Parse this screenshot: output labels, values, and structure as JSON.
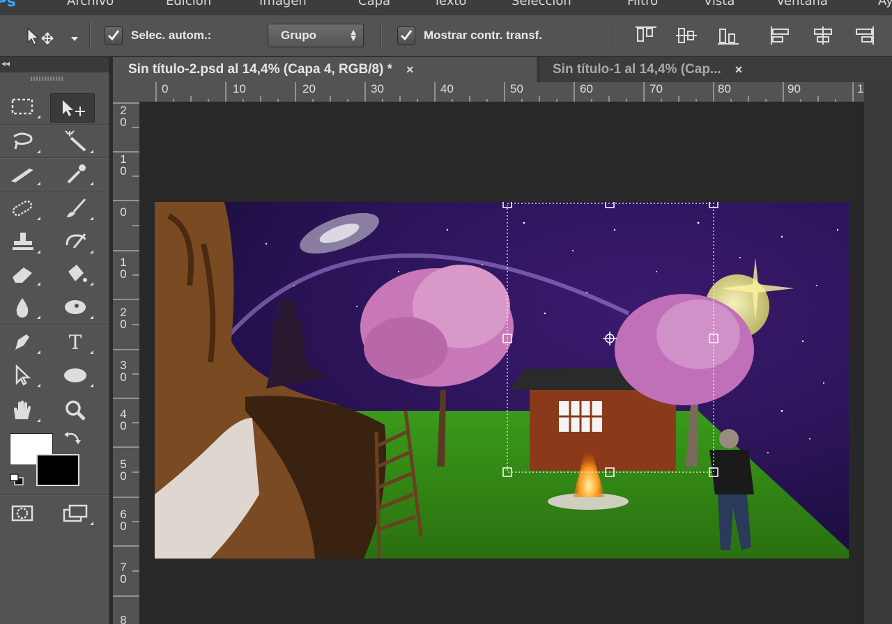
{
  "menubar": {
    "logo": "Ps",
    "items": [
      "Archivo",
      "Edición",
      "Imagen",
      "Capa",
      "Texto",
      "Selección",
      "Filtro",
      "Vista",
      "Ventana",
      "Ayuda"
    ]
  },
  "options": {
    "auto_select_label": "Selec. autom.:",
    "auto_select_checked": true,
    "auto_select_value": "Grupo",
    "show_transform_label": "Mostrar contr. transf.",
    "show_transform_checked": true
  },
  "tabs": [
    {
      "label": "Sin título-2.psd al 14,4% (Capa 4, RGB/8) *",
      "close": "×",
      "active": true
    },
    {
      "label": "Sin título-1 al 14,4% (Cap...",
      "close": "×",
      "active": false
    }
  ],
  "ruler": {
    "h_labels": [
      "0",
      "10",
      "20",
      "30",
      "40",
      "50",
      "60",
      "70",
      "80",
      "90",
      "1"
    ],
    "v_labels": [
      [
        "2",
        "0"
      ],
      [
        "1",
        "0"
      ],
      [
        "0"
      ],
      [
        "1",
        "0"
      ],
      [
        "2",
        "0"
      ],
      [
        "3",
        "0"
      ],
      [
        "4",
        "0"
      ],
      [
        "5",
        "0"
      ],
      [
        "6",
        "0"
      ],
      [
        "7",
        "0"
      ],
      [
        "8"
      ]
    ]
  },
  "tools": {
    "type_glyph": "T"
  },
  "colors": {
    "foreground": "#ffffff",
    "background": "#000000",
    "accent": "#31a8ff",
    "panel": "#535353",
    "workspace": "#282828"
  }
}
